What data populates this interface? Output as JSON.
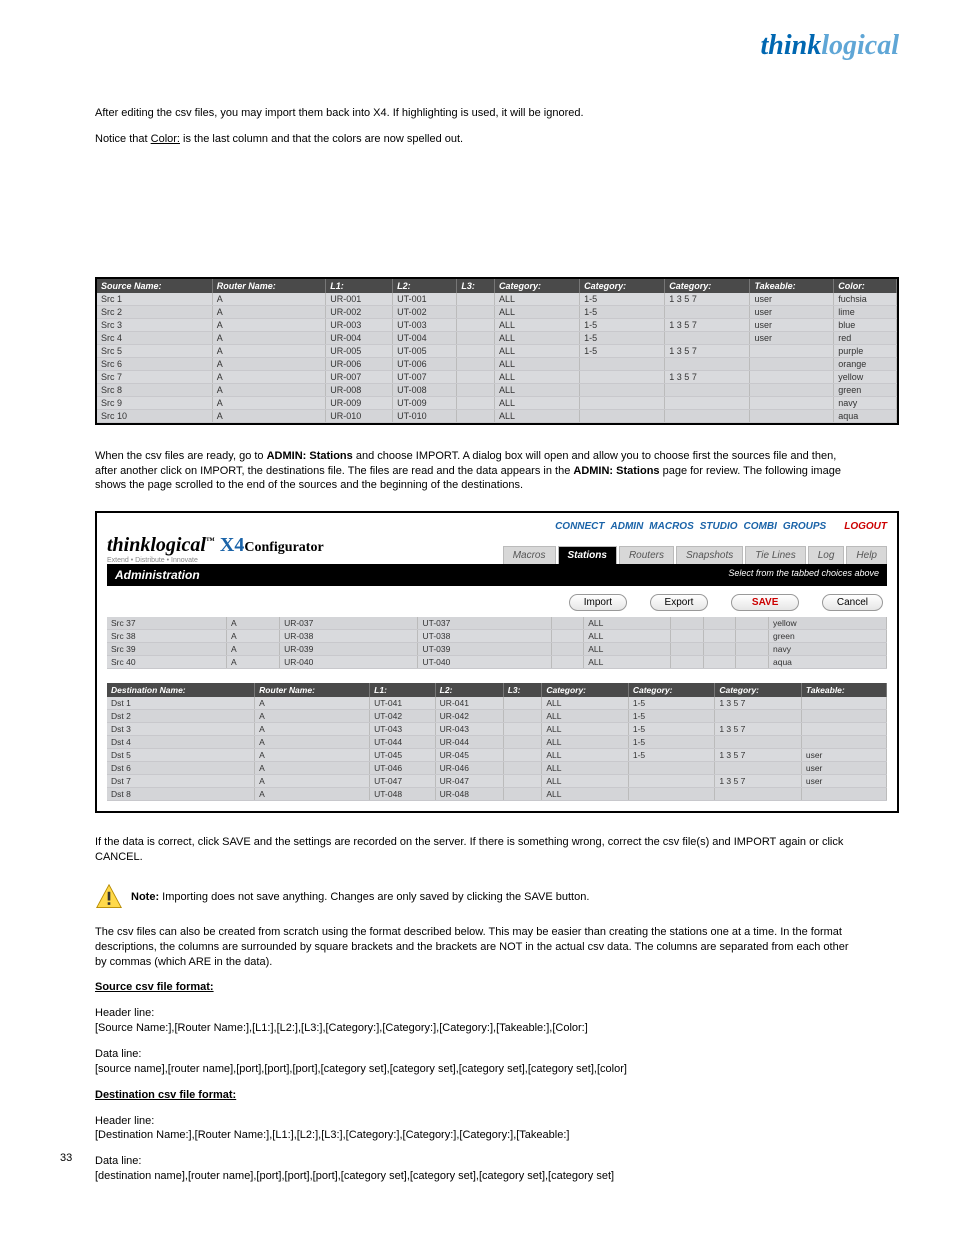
{
  "brand": {
    "part1": "think",
    "part2": "logical"
  },
  "intro1": "After editing the csv files, you may import them back into X4. If highlighting is used, it will be ignored.",
  "intro2a": "Notice that ",
  "intro2b": "Color:",
  "intro2c": " is the last column and that the colors are now spelled out.",
  "srcHeaders": [
    "Source Name:",
    "Router Name:",
    "L1:",
    "L2:",
    "L3:",
    "Category:",
    "Category:",
    "Category:",
    "Takeable:",
    "Color:"
  ],
  "srcRows": [
    [
      "Src 1",
      "A",
      "UR-001",
      "UT-001",
      "",
      "ALL",
      "1-5",
      "1 3 5 7",
      "user",
      "fuchsia"
    ],
    [
      "Src 2",
      "A",
      "UR-002",
      "UT-002",
      "",
      "ALL",
      "1-5",
      "",
      "user",
      "lime"
    ],
    [
      "Src 3",
      "A",
      "UR-003",
      "UT-003",
      "",
      "ALL",
      "1-5",
      "1 3 5 7",
      "user",
      "blue"
    ],
    [
      "Src 4",
      "A",
      "UR-004",
      "UT-004",
      "",
      "ALL",
      "1-5",
      "",
      "user",
      "red"
    ],
    [
      "Src 5",
      "A",
      "UR-005",
      "UT-005",
      "",
      "ALL",
      "1-5",
      "1 3 5 7",
      "",
      "purple"
    ],
    [
      "Src 6",
      "A",
      "UR-006",
      "UT-006",
      "",
      "ALL",
      "",
      "",
      "",
      "orange"
    ],
    [
      "Src 7",
      "A",
      "UR-007",
      "UT-007",
      "",
      "ALL",
      "",
      "1 3 5 7",
      "",
      "yellow"
    ],
    [
      "Src 8",
      "A",
      "UR-008",
      "UT-008",
      "",
      "ALL",
      "",
      "",
      "",
      "green"
    ],
    [
      "Src 9",
      "A",
      "UR-009",
      "UT-009",
      "",
      "ALL",
      "",
      "",
      "",
      "navy"
    ],
    [
      "Src 10",
      "A",
      "UR-010",
      "UT-010",
      "",
      "ALL",
      "",
      "",
      "",
      "aqua"
    ]
  ],
  "para2a": "When the csv files are ready, go to ",
  "para2b": "ADMIN: Stations",
  "para2c": " and choose IMPORT. A dialog box will open and allow you to choose first the sources file and then, after another click on IMPORT, the destinations file. The files are read and the data appears in the ",
  "para2d": "ADMIN: Stations",
  "para2e": " page for review. The following image shows the page scrolled to the end of the sources and the beginning of the destinations.",
  "shot": {
    "nav": [
      "CONNECT",
      "ADMIN",
      "MACROS",
      "STUDIO",
      "COMBI",
      "GROUPS"
    ],
    "logout": "LOGOUT",
    "logo_p1": "think",
    "logo_p2": "logical",
    "logo_x4": "X4",
    "logo_cfg": "Configurator",
    "logo_sub": "Extend • Distribute • Innovate",
    "tabs": [
      "Macros",
      "Stations",
      "Routers",
      "Snapshots",
      "Tie Lines",
      "Log",
      "Help"
    ],
    "activeTab": "Stations",
    "admin_label": "Administration",
    "admin_hint": "Select from the tabbed choices above",
    "btn_import": "Import",
    "btn_export": "Export",
    "btn_save": "SAVE",
    "btn_cancel": "Cancel",
    "srcTail": [
      [
        "Src 37",
        "A",
        "UR-037",
        "UT-037",
        "",
        "ALL",
        "",
        "",
        "",
        "yellow"
      ],
      [
        "Src 38",
        "A",
        "UR-038",
        "UT-038",
        "",
        "ALL",
        "",
        "",
        "",
        "green"
      ],
      [
        "Src 39",
        "A",
        "UR-039",
        "UT-039",
        "",
        "ALL",
        "",
        "",
        "",
        "navy"
      ],
      [
        "Src 40",
        "A",
        "UR-040",
        "UT-040",
        "",
        "ALL",
        "",
        "",
        "",
        "aqua"
      ]
    ],
    "dstHeaders": [
      "Destination Name:",
      "Router Name:",
      "L1:",
      "L2:",
      "L3:",
      "Category:",
      "Category:",
      "Category:",
      "Takeable:"
    ],
    "dstRows": [
      [
        "Dst 1",
        "A",
        "UT-041",
        "UR-041",
        "",
        "ALL",
        "1-5",
        "1 3 5 7",
        ""
      ],
      [
        "Dst 2",
        "A",
        "UT-042",
        "UR-042",
        "",
        "ALL",
        "1-5",
        "",
        ""
      ],
      [
        "Dst 3",
        "A",
        "UT-043",
        "UR-043",
        "",
        "ALL",
        "1-5",
        "1 3 5 7",
        ""
      ],
      [
        "Dst 4",
        "A",
        "UT-044",
        "UR-044",
        "",
        "ALL",
        "1-5",
        "",
        ""
      ],
      [
        "Dst 5",
        "A",
        "UT-045",
        "UR-045",
        "",
        "ALL",
        "1-5",
        "1 3 5 7",
        "user"
      ],
      [
        "Dst 6",
        "A",
        "UT-046",
        "UR-046",
        "",
        "ALL",
        "",
        "",
        "user"
      ],
      [
        "Dst 7",
        "A",
        "UT-047",
        "UR-047",
        "",
        "ALL",
        "",
        "1 3 5 7",
        "user"
      ],
      [
        "Dst 8",
        "A",
        "UT-048",
        "UR-048",
        "",
        "ALL",
        "",
        "",
        ""
      ]
    ]
  },
  "para3": "If the data is correct, click SAVE and the settings are recorded on the server. If there is something wrong, correct the csv file(s) and IMPORT again or click CANCEL.",
  "note_b": "Note: ",
  "note": "Importing does not save anything. Changes are only saved by clicking the SAVE button.",
  "para4": "The csv files can also be created from scratch using the format described below. This may be easier than creating the stations one at a time. In the format descriptions, the columns are surrounded by square brackets and the brackets are NOT in the actual csv data. The columns are separated from each other by commas (which ARE in the data).",
  "hdr_src": "Source csv file format:",
  "fmt_hdr": "Header line:",
  "fmt_hdr_src": "[Source Name:],[Router Name:],[L1:],[L2:],[L3:],[Category:],[Category:],[Category:],[Takeable:],[Color:]",
  "fmt_data": "Data line:",
  "fmt_data_src": "[source name],[router name],[port],[port],[port],[category set],[category set],[category set],[category set],[color]",
  "hdr_dst": "Destination csv file format:",
  "fmt_hdr_dst": "[Destination Name:],[Router Name:],[L1:],[L2:],[L3:],[Category:],[Category:],[Category:],[Takeable:]",
  "fmt_data_dst": "[destination name],[router name],[port],[port],[port],[category set],[category set],[category set],[category set]",
  "page_num": "33"
}
